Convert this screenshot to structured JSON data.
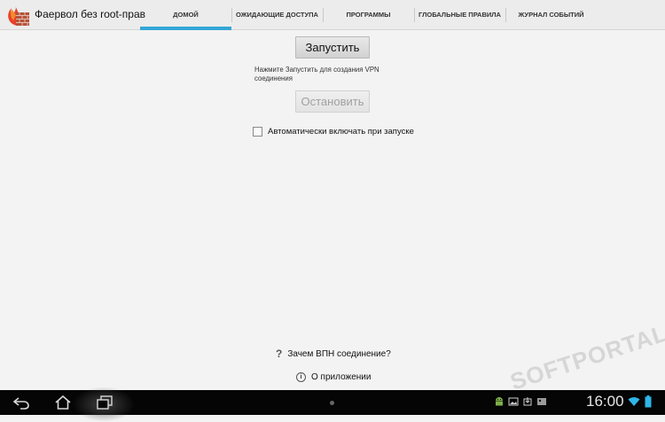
{
  "app": {
    "title": "Фаервол без root-прав"
  },
  "tabs": [
    {
      "label": "Домой",
      "active": true
    },
    {
      "label": "Ожидающие доступа",
      "active": false
    },
    {
      "label": "Программы",
      "active": false
    },
    {
      "label": "Глобальные правила",
      "active": false
    },
    {
      "label": "Журнал событий",
      "active": false
    }
  ],
  "main": {
    "start_label": "Запустить",
    "hint": "Нажмите Запустить для создания VPN соединения",
    "stop_label": "Остановить",
    "stop_enabled": false,
    "autostart_label": "Автоматически включать при запуске",
    "autostart_checked": false,
    "why_vpn_label": "Зачем ВПН соединение?",
    "about_label": "О приложении"
  },
  "watermark": "SOFTPORTAL",
  "system_bar": {
    "clock": "16:00",
    "icons": [
      "back-icon",
      "home-icon",
      "recents-icon",
      "android-icon",
      "image-icon",
      "download-icon",
      "wifi-icon",
      "battery-icon"
    ]
  },
  "colors": {
    "accent": "#33a6d6",
    "background": "#f3f3f3",
    "system_bar": "#050505"
  }
}
